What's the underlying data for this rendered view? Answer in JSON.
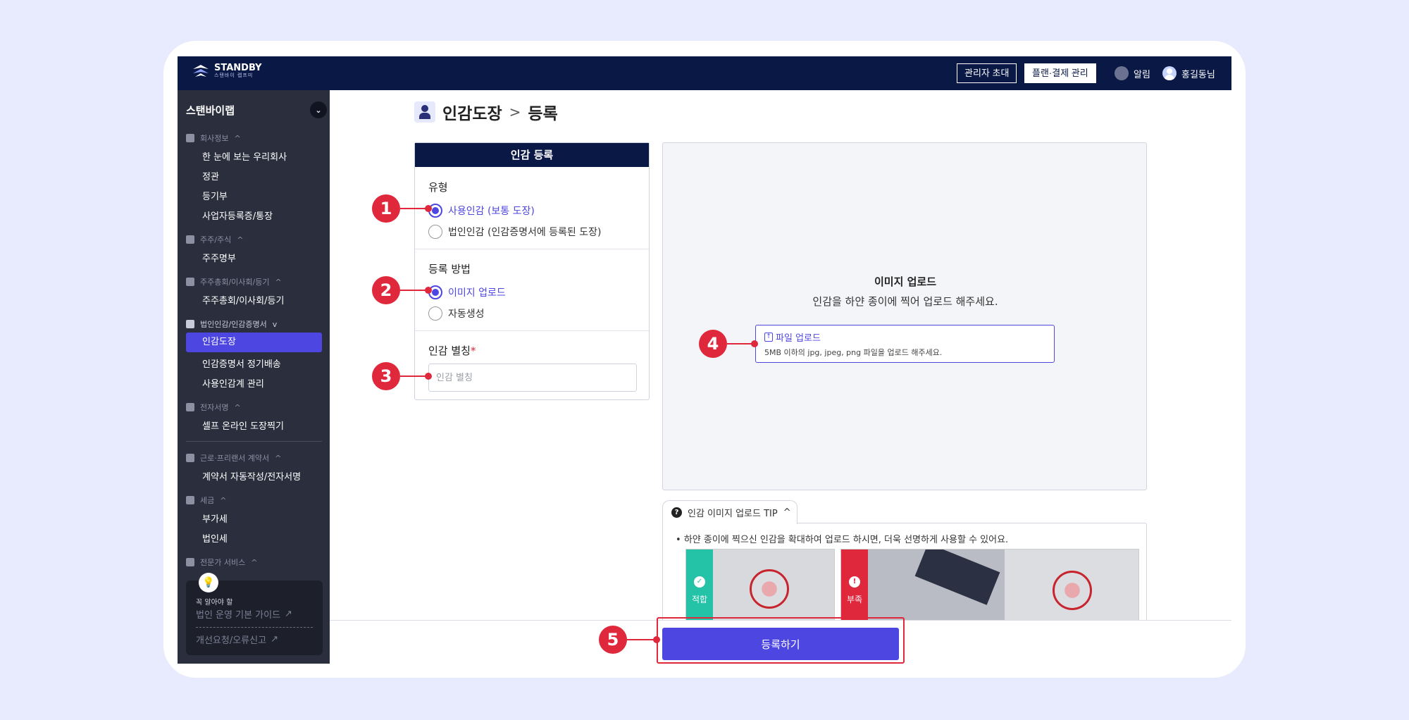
{
  "brand": {
    "name": "STANDBY",
    "sub": "스탠바이 렙프미"
  },
  "topbar": {
    "invite_admin": "관리자 초대",
    "plan_billing": "플랜·결제 관리",
    "notifications": "알림",
    "user_name": "홍길동님"
  },
  "sidebar": {
    "org_name": "스탠바이랩",
    "sections": [
      {
        "title": "회사정보",
        "items": [
          "한 눈에 보는 우리회사",
          "정관",
          "등기부",
          "사업자등록증/통장"
        ]
      },
      {
        "title": "주주/주식",
        "items": [
          "주주명부"
        ]
      },
      {
        "title": "주주총회/이사회/등기",
        "items": [
          "주주총회/이사회/등기"
        ]
      },
      {
        "title": "법인인감/인감증명서",
        "items": [
          "인감도장",
          "인감증명서 정기배송",
          "사용인감계 관리"
        ]
      },
      {
        "title": "전자서명",
        "items": [
          "셀프 온라인 도장찍기"
        ]
      },
      {
        "title": "근로·프리랜서 계약서",
        "items": [
          "계약서 자동작성/전자서명"
        ]
      },
      {
        "title": "세금",
        "items": [
          "부가세",
          "법인세"
        ]
      },
      {
        "title": "전문가 서비스",
        "items": []
      }
    ],
    "active_item": "인감도장",
    "guide": {
      "small": "꼭 알아야 할",
      "link1": "법인 운영 기본 가이드",
      "link2": "개선요청/오류신고"
    }
  },
  "page": {
    "crumb_parent": "인감도장",
    "crumb_sep": ">",
    "crumb_current": "등록"
  },
  "form": {
    "header": "인감 등록",
    "type_title": "유형",
    "type_options": [
      "사용인감 (보통 도장)",
      "법인인감 (인감증명서에 등록된 도장)"
    ],
    "type_selected": 0,
    "method_title": "등록 방법",
    "method_options": [
      "이미지 업로드",
      "자동생성"
    ],
    "method_selected": 0,
    "alias_title": "인감 별칭",
    "alias_required": "*",
    "alias_placeholder": "인감 별칭",
    "alias_value": ""
  },
  "upload": {
    "title": "이미지 업로드",
    "subtitle": "인감을 하얀 종이에 찍어 업로드 해주세요.",
    "link": "파일 업로드",
    "note": "5MB 이하의 jpg, jpeg, png 파일을 업로드 해주세요."
  },
  "tip": {
    "tab": "인감 이미지 업로드 TIP",
    "text": "하얀 종이에 찍으신 인감을 확대하여 업로드 하시면, 더욱 선명하게 사용할 수 있어요.",
    "good": "적합",
    "bad": "부족"
  },
  "submit_label": "등록하기",
  "annotations": [
    "1",
    "2",
    "3",
    "4",
    "5"
  ],
  "colors": {
    "navy": "#0a1845",
    "accent": "#4d46e0",
    "annotation": "#e0283c",
    "good": "#24c3a8",
    "bad": "#e0283c"
  }
}
